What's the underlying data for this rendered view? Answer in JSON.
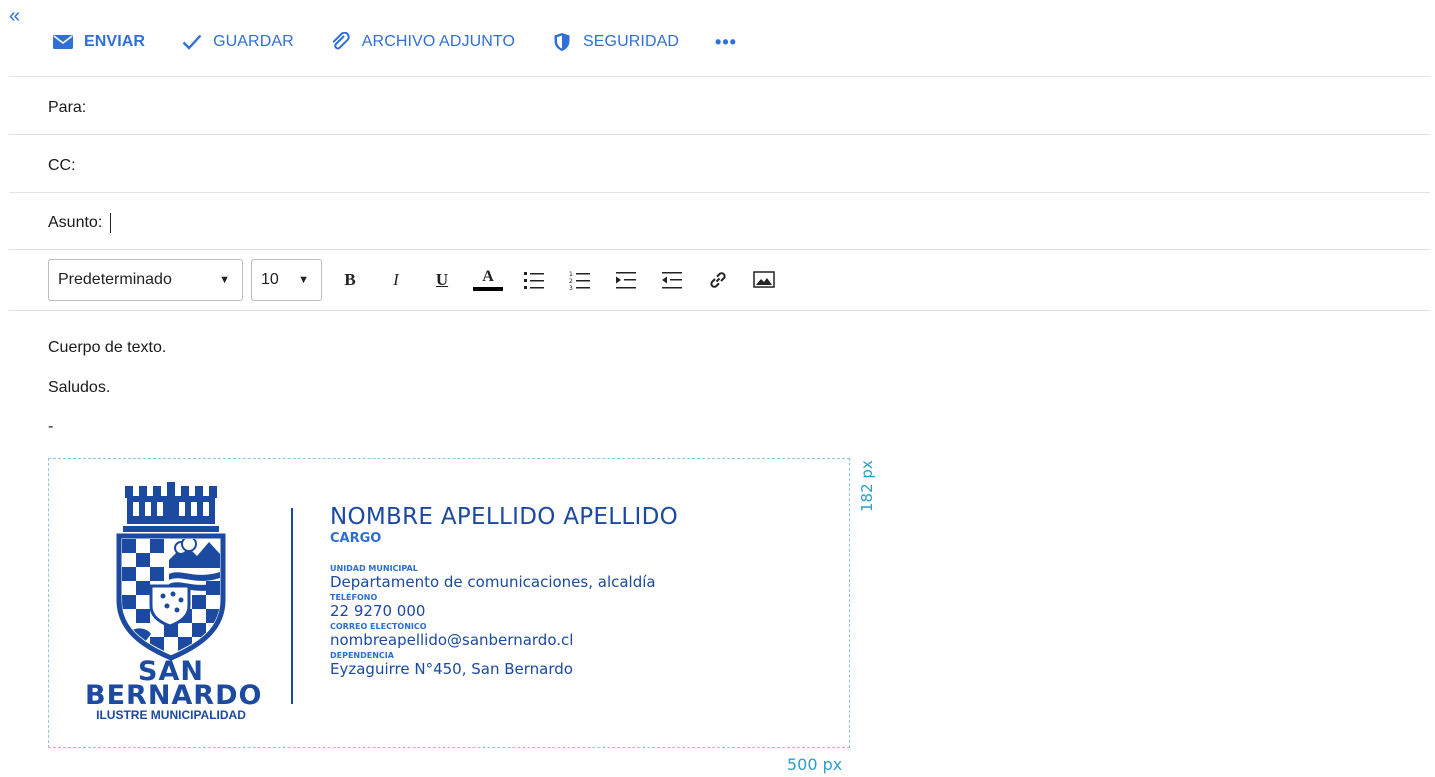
{
  "toolbar": {
    "collapse_icon": "double-chevron-left-icon",
    "send_label": "ENVIAR",
    "save_label": "GUARDAR",
    "attach_label": "ARCHIVO ADJUNTO",
    "security_label": "SEGURIDAD",
    "more_label": "•••"
  },
  "fields": {
    "to_label": "Para:",
    "cc_label": "CC:",
    "subject_label": "Asunto:"
  },
  "format": {
    "font_value": "Predeterminado",
    "size_value": "10",
    "bold": "B",
    "italic": "I",
    "underline": "U",
    "color": "A"
  },
  "body": {
    "line1": "Cuerpo de texto.",
    "line2": "Saludos.",
    "line3": "-"
  },
  "signature": {
    "logo_line1": "SAN",
    "logo_line2": "BERNARDO",
    "logo_line3": "ILUSTRE MUNICIPALIDAD",
    "name": "NOMBRE APELLIDO APELLIDO",
    "cargo": "CARGO",
    "unit_label": "UNIDAD MUNICIPAL",
    "unit_value": "Departamento de comunicaciones, alcaldía",
    "phone_label": "TELÉFONO",
    "phone_value": "22 9270 000",
    "email_label": "CORREO ELECTÓNICO",
    "email_value": "nombreapellido@sanbernardo.cl",
    "dep_label": "DEPENDENCIA",
    "dep_value": "Eyzaguirre N°450, San Bernardo",
    "width_note": "500 px",
    "height_note": "182 px"
  },
  "colors": {
    "accent": "#2f6fd6",
    "brand": "#1b4aa0",
    "guide": "#2aa0c9"
  }
}
